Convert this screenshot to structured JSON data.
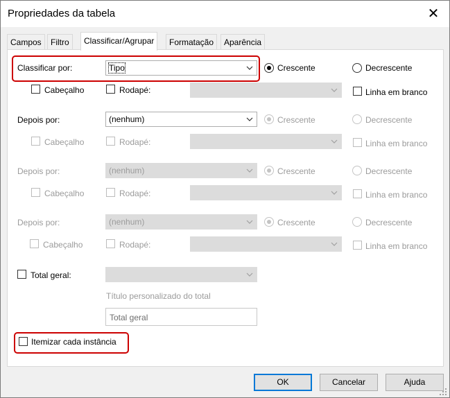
{
  "window": {
    "title": "Propriedades da tabela",
    "close_glyph": "✕"
  },
  "tabs": [
    {
      "label": "Campos"
    },
    {
      "label": "Filtro"
    },
    {
      "label": "Classificar/Agrupar"
    },
    {
      "label": "Formatação"
    },
    {
      "label": "Aparência"
    }
  ],
  "rows": [
    {
      "label": "Classificar por:",
      "value": "Tipo",
      "asc": "Crescente",
      "desc": "Decrescente",
      "header": "Cabeçalho",
      "footer": "Rodapé:",
      "blank": "Linha em branco"
    },
    {
      "label": "Depois por:",
      "value": "(nenhum)",
      "asc": "Crescente",
      "desc": "Decrescente",
      "header": "Cabeçalho",
      "footer": "Rodapé:",
      "blank": "Linha em branco"
    },
    {
      "label": "Depois por:",
      "value": "(nenhum)",
      "asc": "Crescente",
      "desc": "Decrescente",
      "header": "Cabeçalho",
      "footer": "Rodapé:",
      "blank": "Linha em branco"
    },
    {
      "label": "Depois por:",
      "value": "(nenhum)",
      "asc": "Crescente",
      "desc": "Decrescente",
      "header": "Cabeçalho",
      "footer": "Rodapé:",
      "blank": "Linha em branco"
    }
  ],
  "total": {
    "label": "Total geral:",
    "custom_title_label": "Título personalizado do total",
    "custom_title_value": "Total geral"
  },
  "itemize": {
    "label": "Itemizar cada instância"
  },
  "buttons": {
    "ok": "OK",
    "cancel": "Cancelar",
    "help": "Ajuda"
  },
  "colors": {
    "highlight": "#cc0000",
    "accent": "#0078d7",
    "disabled_text": "#9b9b9b"
  }
}
